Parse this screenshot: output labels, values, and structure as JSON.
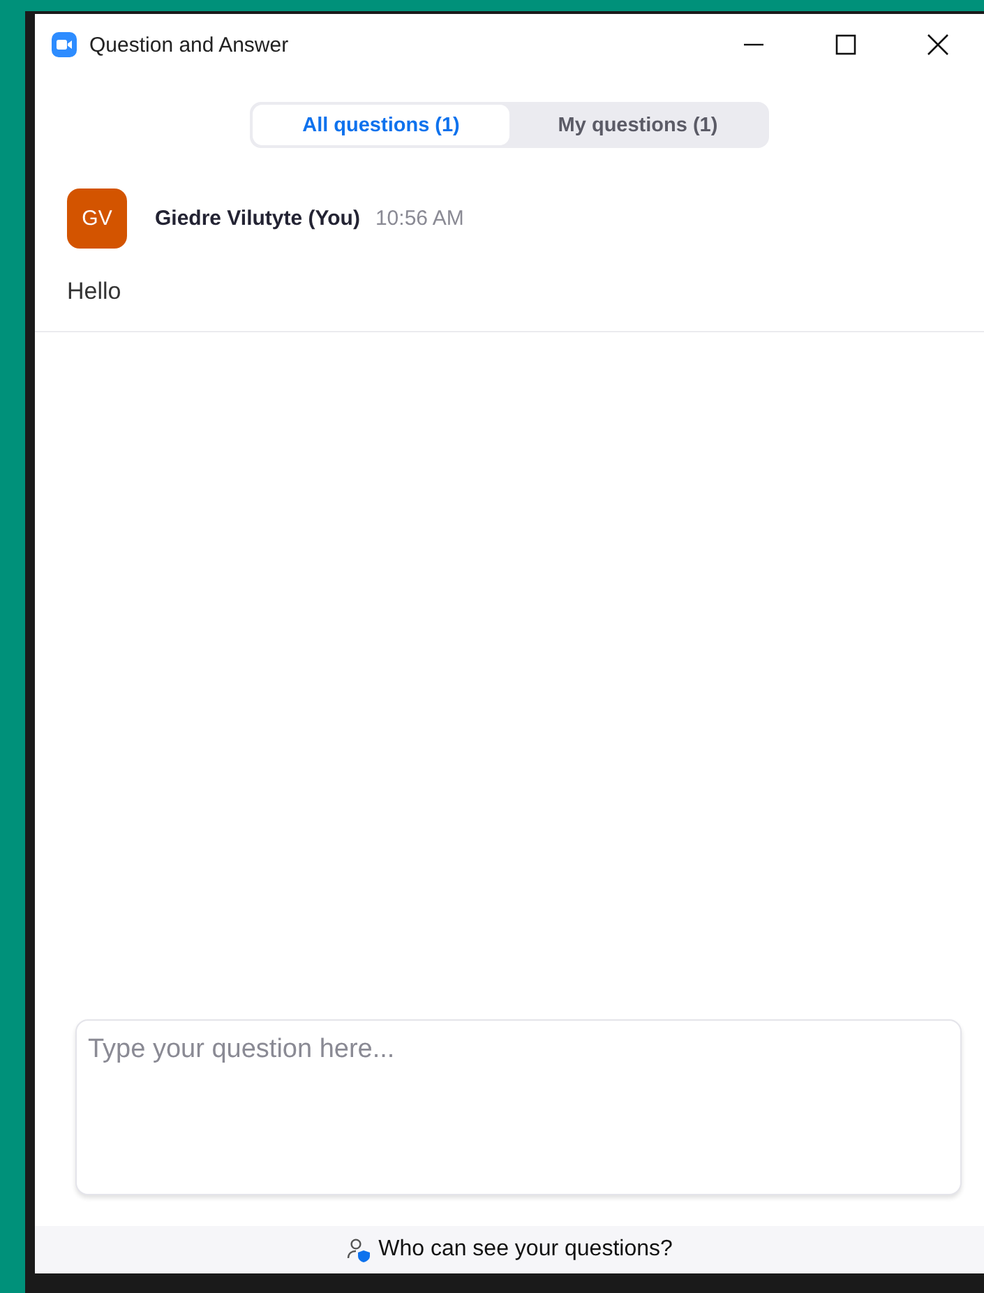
{
  "window": {
    "title": "Question and Answer"
  },
  "tabs": [
    {
      "label": "All questions (1)",
      "selected": true
    },
    {
      "label": "My questions (1)",
      "selected": false
    }
  ],
  "questions": [
    {
      "initials": "GV",
      "author": "Giedre Vilutyte (You)",
      "time": "10:56 AM",
      "text": "Hello"
    }
  ],
  "composer": {
    "placeholder": "Type your question here..."
  },
  "footer": {
    "link": "Who can see your questions?"
  }
}
